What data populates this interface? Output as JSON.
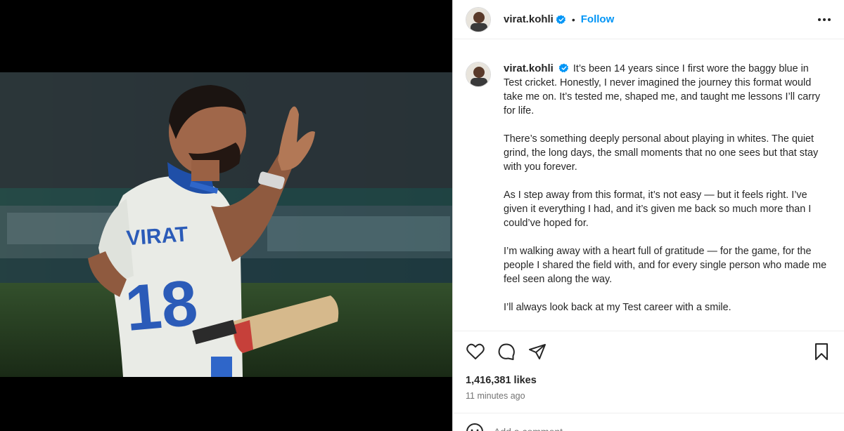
{
  "post": {
    "username": "virat.kohli",
    "dot": "•",
    "follow_label": "Follow",
    "caption_paragraphs": [
      "It’s been 14 years since I first wore the baggy blue in Test cricket. Honestly, I never imagined the journey this format would take me on. It’s tested me, shaped me, and taught me lessons I’ll carry for life.",
      "There’s something deeply personal about playing in whites. The quiet grind, the long days, the small moments that no one sees but that stay with you forever.",
      "As I step away from this format, it’s not easy — but it feels right. I’ve given it everything I had, and it’s given me back so much more than I could’ve hoped for.",
      "I’m walking away with a heart full of gratitude — for the game, for the people I shared the field with, and for every single person who made me feel seen along the way.",
      "I’ll always look back at my Test career with a smile."
    ],
    "likes": "1,416,381 likes",
    "time_ago": "11 minutes ago",
    "comment_placeholder": "Add a comment..."
  },
  "photo": {
    "jersey_name": "VIRAT",
    "jersey_number": "18"
  },
  "colors": {
    "accent": "#0095f6",
    "verified": "#0095f6",
    "muted": "#737373"
  },
  "icons": [
    "verified-badge-icon",
    "more-options-icon",
    "heart-icon",
    "comment-icon",
    "share-icon",
    "bookmark-icon",
    "emoji-icon"
  ]
}
